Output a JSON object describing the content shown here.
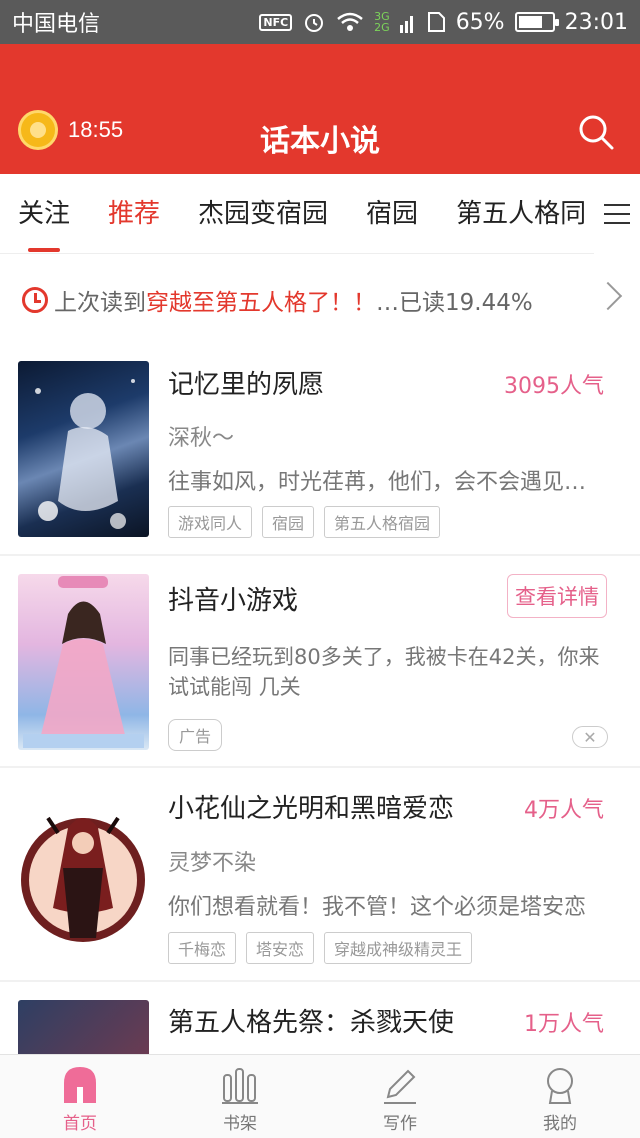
{
  "status_bar": {
    "carrier": "中国电信",
    "icons": [
      "nfc-icon",
      "alarm-icon",
      "wifi-icon",
      "signal-3g-2g-icon",
      "sim-icon"
    ],
    "network_labels": [
      "3G",
      "2G"
    ],
    "battery_percent": "65%",
    "battery_level": 0.65,
    "time": "23:01"
  },
  "header": {
    "timer": "18:55",
    "title": "话本小说",
    "accent_color": "#e3382d"
  },
  "tabs": [
    {
      "label": "关注"
    },
    {
      "label": "推荐"
    },
    {
      "label": "杰园变宿园"
    },
    {
      "label": "宿园"
    },
    {
      "label": "第五人格同"
    }
  ],
  "last_read": {
    "prefix": "上次读到",
    "title": "穿越至第五人格了！！",
    "suffix": "…已读19.44%"
  },
  "books": [
    {
      "title": "记忆里的夙愿",
      "popularity": "3095人气",
      "author": "深秋～",
      "desc": "往事如风，时光荏苒，他们，会不会遇见彼此呢",
      "tags": [
        "游戏同人",
        "宿园",
        "第五人格宿园"
      ]
    },
    {
      "title": "小花仙之光明和黑暗爱恋",
      "popularity": "4万人气",
      "author": "灵梦不染",
      "desc": "你们想看就看！我不管！这个必须是塔安恋",
      "tags": [
        "千梅恋",
        "塔安恋",
        "穿越成神级精灵王"
      ]
    },
    {
      "title": "第五人格先祭：杀戮天使",
      "popularity": "1万人气"
    }
  ],
  "ad": {
    "title": "抖音小游戏",
    "button": "查看详情",
    "desc": "同事已经玩到80多关了，我被卡在42关，你来试试能闯 几关",
    "tag": "广告",
    "close": "✕"
  },
  "bottom_nav": [
    {
      "label": "首页",
      "icon": "home-icon"
    },
    {
      "label": "书架",
      "icon": "bookshelf-icon"
    },
    {
      "label": "写作",
      "icon": "pen-icon"
    },
    {
      "label": "我的",
      "icon": "profile-icon"
    }
  ]
}
